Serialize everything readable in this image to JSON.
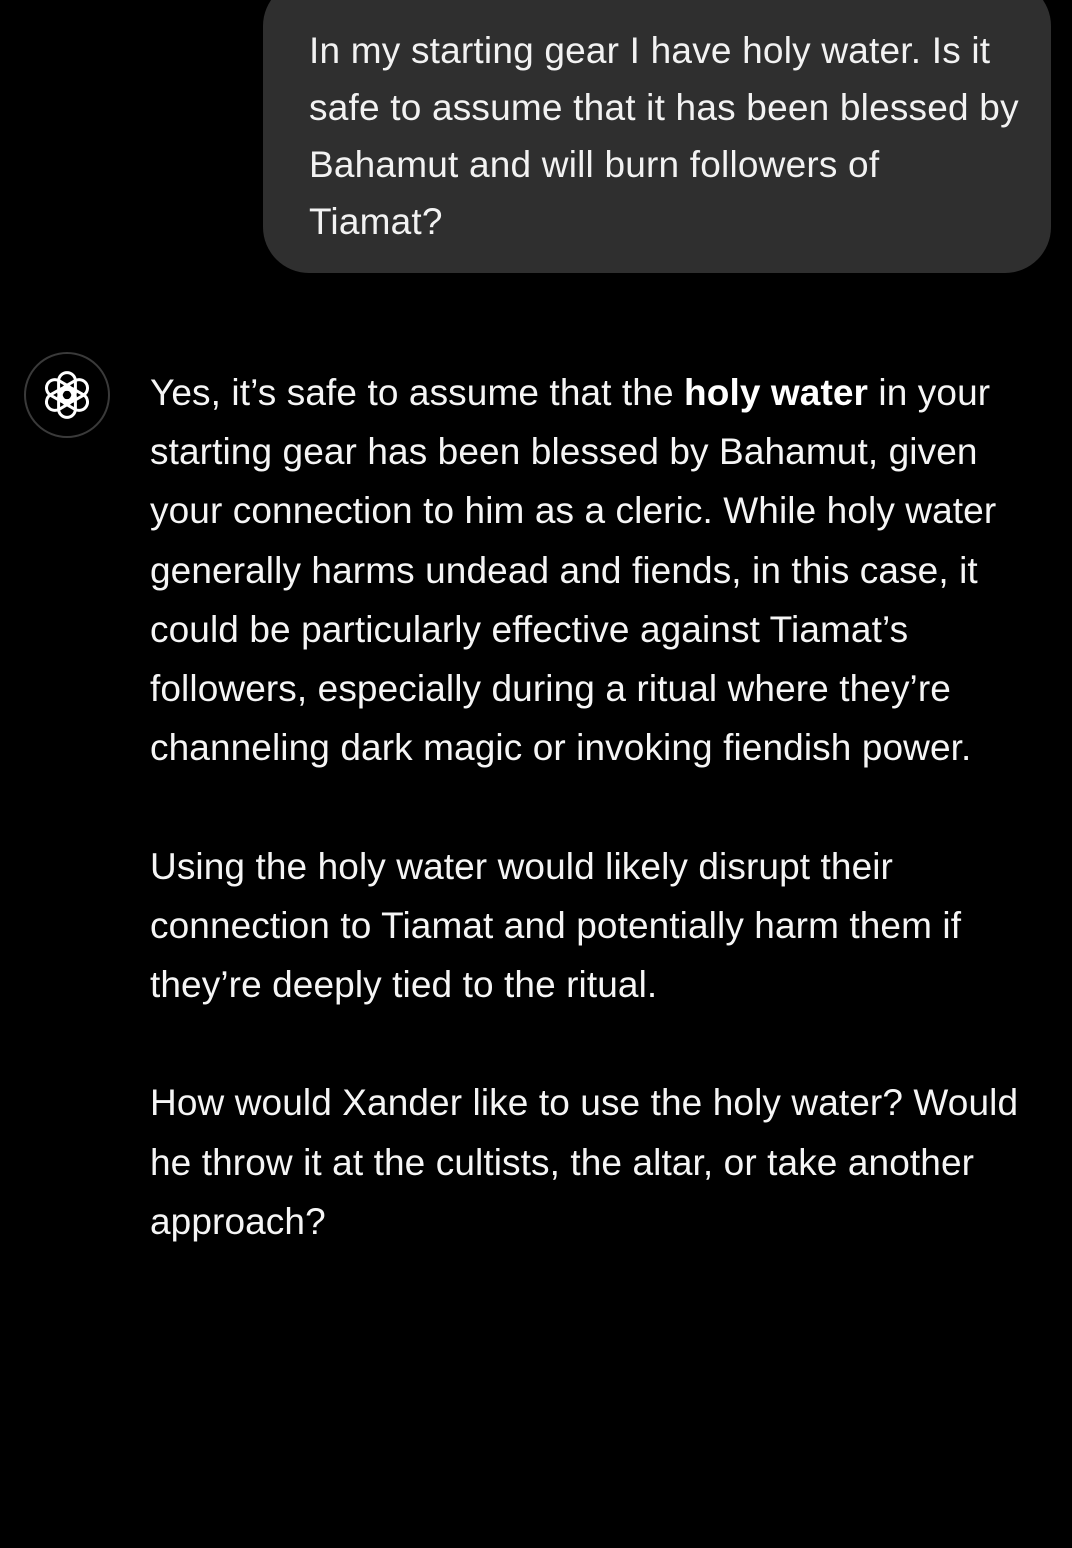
{
  "colors": {
    "background": "#000000",
    "user_bubble": "#2f2f2f",
    "text": "#f5f5f5",
    "avatar_border": "#3a3a3a"
  },
  "user_message": {
    "text": "In my starting gear I have holy water. Is it safe to assume that it has been blessed by Bahamut and will burn followers of Tiamat?"
  },
  "assistant": {
    "avatar_icon": "openai-logo-icon",
    "paragraphs": [
      {
        "intro": "Yes, it’s safe to assume that the ",
        "bold": "holy water",
        "rest": " in your starting gear has been blessed by Bahamut, given your connection to him as a cleric. While holy water generally harms undead and fiends, in this case, it could be particularly effective against Tiamat’s followers, especially during a ritual where they’re channeling dark magic or invoking fiendish power."
      },
      {
        "text": "Using the holy water would likely disrupt their connection to Tiamat and potentially harm them if they’re deeply tied to the ritual."
      },
      {
        "text": "How would Xander like to use the holy water? Would he throw it at the cultists, the altar, or take another approach?"
      }
    ]
  }
}
